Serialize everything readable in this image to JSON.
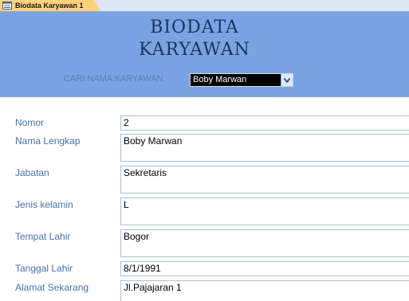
{
  "tab": {
    "label": "Biodata Karyawan 1",
    "icon": "form-icon"
  },
  "header": {
    "title_line1": "BIODATA",
    "title_line2": "KARYAWAN",
    "search_label": "CARI NAMA KARYAWAN",
    "search_value": "Boby Marwan",
    "dropdown_icon": "chevron-down-icon"
  },
  "fields": [
    {
      "label": "Nomor",
      "value": "2"
    },
    {
      "label": "Nama Lengkap",
      "value": "Boby Marwan"
    },
    {
      "label": "Jabatan",
      "value": "Sekretaris"
    },
    {
      "label": "Jenis kelamin",
      "value": "L"
    },
    {
      "label": "Tempat Lahir",
      "value": "Bogor"
    },
    {
      "label": "Tanggal Lahir",
      "value": "8/1/1991"
    },
    {
      "label": "Alamat Sekarang",
      "value": "Jl.Pajajaran 1"
    }
  ]
}
